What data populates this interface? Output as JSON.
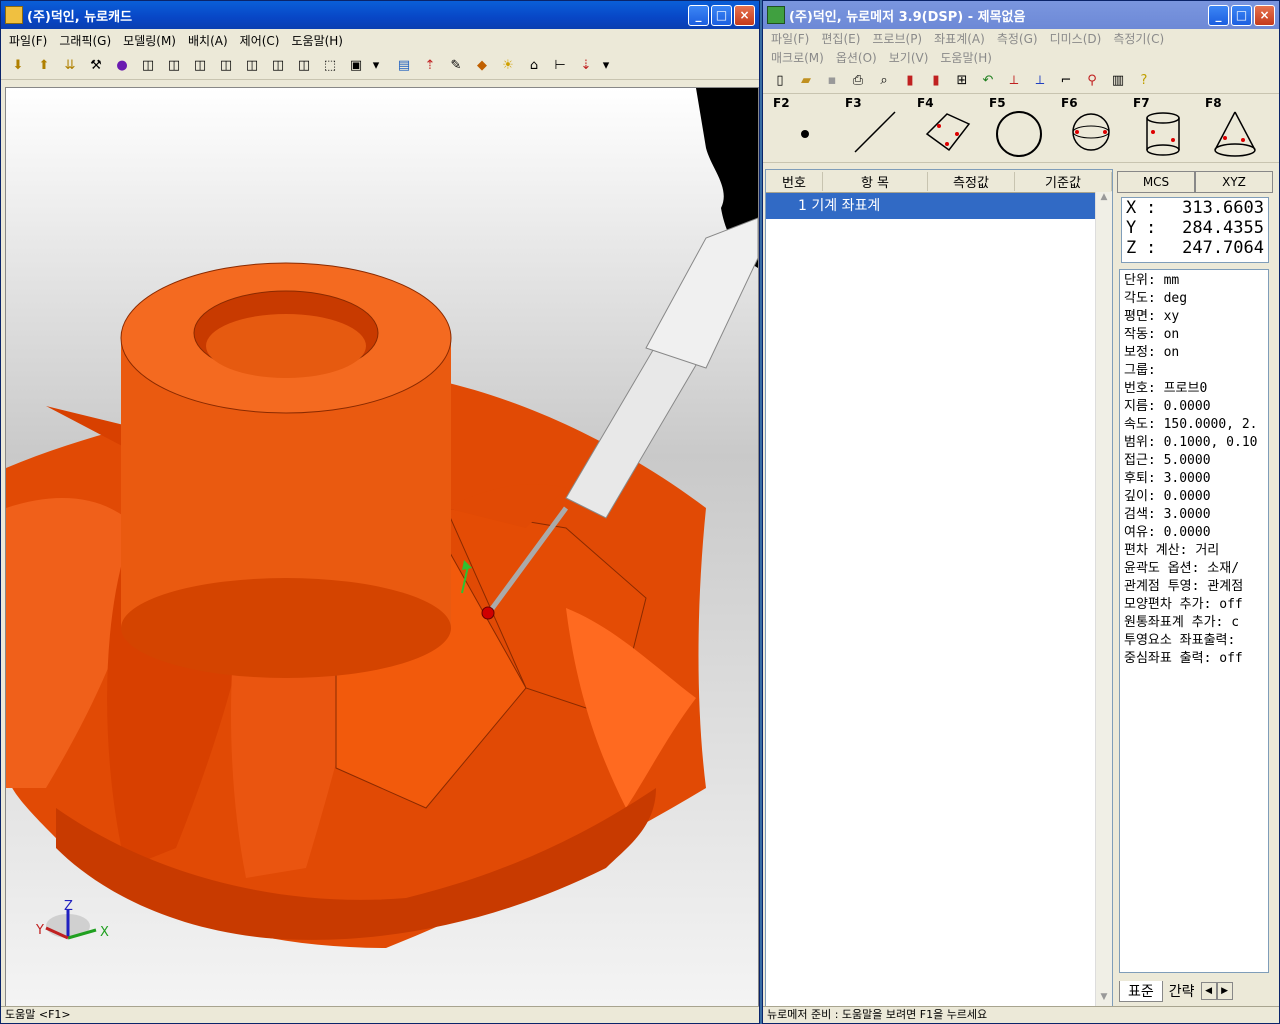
{
  "left_window": {
    "title": "(주)덕인, 뉴로캐드",
    "menu": [
      "파일(F)",
      "그래픽(G)",
      "모델링(M)",
      "배치(A)",
      "제어(C)",
      "도움말(H)"
    ],
    "status": "도움말 <F1>",
    "axes": {
      "x": "X",
      "y": "Y",
      "z": "Z"
    }
  },
  "right_window": {
    "title": "(주)덕인, 뉴로메저 3.9(DSP) - 제목없음",
    "menu_row1": [
      "파일(F)",
      "편집(E)",
      "프로브(P)",
      "좌표계(A)",
      "측정(G)",
      "디미스(D)",
      "측정기(C)"
    ],
    "menu_row2": [
      "매크로(M)",
      "옵션(O)",
      "보기(V)",
      "도움말(H)"
    ],
    "fkeys": [
      "F2",
      "F3",
      "F4",
      "F5",
      "F6",
      "F7",
      "F8"
    ],
    "list_headers": [
      "번호",
      "항 목",
      "측정값",
      "기준값"
    ],
    "list_rows": [
      {
        "text": "1 기계 좌표계"
      }
    ],
    "coord_tabs": [
      "MCS",
      "XYZ"
    ],
    "coords": [
      {
        "axis": "X",
        "sep": ":",
        "value": "313.6603"
      },
      {
        "axis": "Y",
        "sep": ":",
        "value": "284.4355"
      },
      {
        "axis": "Z",
        "sep": ":",
        "value": "247.7064"
      }
    ],
    "props": [
      "단위: mm",
      "각도: deg",
      "평면: xy",
      "작동: on",
      "보정: on",
      "그룹:",
      "번호: 프로브0",
      "지름: 0.0000",
      "속도: 150.0000, 2.",
      "범위: 0.1000, 0.10",
      "접근: 5.0000",
      "후퇴: 3.0000",
      "깊이: 0.0000",
      "검색: 3.0000",
      "여유: 0.0000",
      "편차 계산: 거리",
      "윤곽도 옵션: 소재/",
      "관계점 투영: 관계점",
      "모양편차 추가: off",
      "원통좌표계 추가: c",
      "투영요소 좌표출력:",
      "중심좌표 출력: off"
    ],
    "bottom_tabs": [
      "표준",
      "간략"
    ],
    "status": "뉴로메저 준비 : 도움말을 보려면 F1을 누르세요"
  }
}
